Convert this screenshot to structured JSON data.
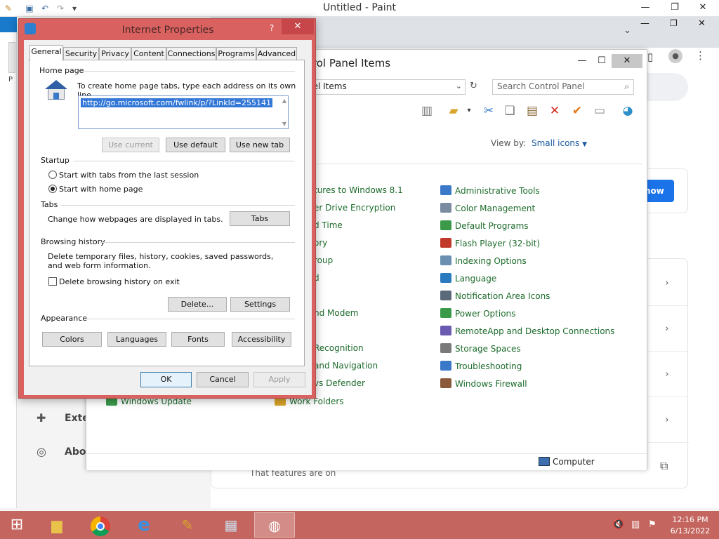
{
  "paint": {
    "title": "Untitled - Paint",
    "status_left": "P"
  },
  "chrome": {
    "show_button": "how",
    "extensions_label": "Exter",
    "about_label": "Abou",
    "card_text": "That features are on"
  },
  "control_panel": {
    "title": "trol Panel Items",
    "address": "nel Items",
    "search_placeholder": "Search Control Panel",
    "view_by_label": "View by:",
    "view_by_value": "Small icons",
    "status_computer": "Computer",
    "col1": [
      "tures to Windows 8.1",
      "er Drive Encryption",
      "d Time",
      "ory",
      "roup",
      "d",
      "",
      "nd Modem",
      "",
      "Recognition",
      "and Navigation",
      "vs Defender"
    ],
    "col1_extra": [
      "Windows Update"
    ],
    "col_mid_extra": [
      "Work Folders"
    ],
    "col2": [
      "Administrative Tools",
      "Color Management",
      "Default Programs",
      "Flash Player (32-bit)",
      "Indexing Options",
      "Language",
      "Notification Area Icons",
      "Power Options",
      "RemoteApp and Desktop Connections",
      "Storage Spaces",
      "Troubleshooting",
      "Windows Firewall"
    ]
  },
  "dialog": {
    "title": "Internet Properties",
    "help": "?",
    "close": "✕",
    "tabs": [
      "General",
      "Security",
      "Privacy",
      "Content",
      "Connections",
      "Programs",
      "Advanced"
    ],
    "home_page": {
      "heading": "Home page",
      "instruction": "To create home page tabs, type each address on its own line.",
      "url": "http://go.microsoft.com/fwlink/p/?LinkId=255141",
      "use_current": "Use current",
      "use_default": "Use default",
      "use_new_tab": "Use new tab"
    },
    "startup": {
      "heading": "Startup",
      "option1": "Start with tabs from the last session",
      "option2": "Start with home page",
      "selected": 2
    },
    "tabs_section": {
      "heading": "Tabs",
      "text": "Change how webpages are displayed in tabs.",
      "button": "Tabs"
    },
    "browsing_history": {
      "heading": "Browsing history",
      "text": "Delete temporary files, history, cookies, saved passwords, and web form information.",
      "checkbox_label": "Delete browsing history on exit",
      "checked": false,
      "delete_button": "Delete...",
      "settings_button": "Settings"
    },
    "appearance": {
      "heading": "Appearance",
      "colors": "Colors",
      "languages": "Languages",
      "fonts": "Fonts",
      "accessibility": "Accessibility"
    },
    "ok": "OK",
    "cancel": "Cancel",
    "apply": "Apply"
  },
  "taskbar": {
    "time": "12:16 PM",
    "date": "6/13/2022"
  },
  "colors": {
    "dialog_frame": "#d9615f",
    "taskbar": "#c4665f",
    "link_green": "#1c6b2b",
    "selection_blue": "#3378d7"
  }
}
